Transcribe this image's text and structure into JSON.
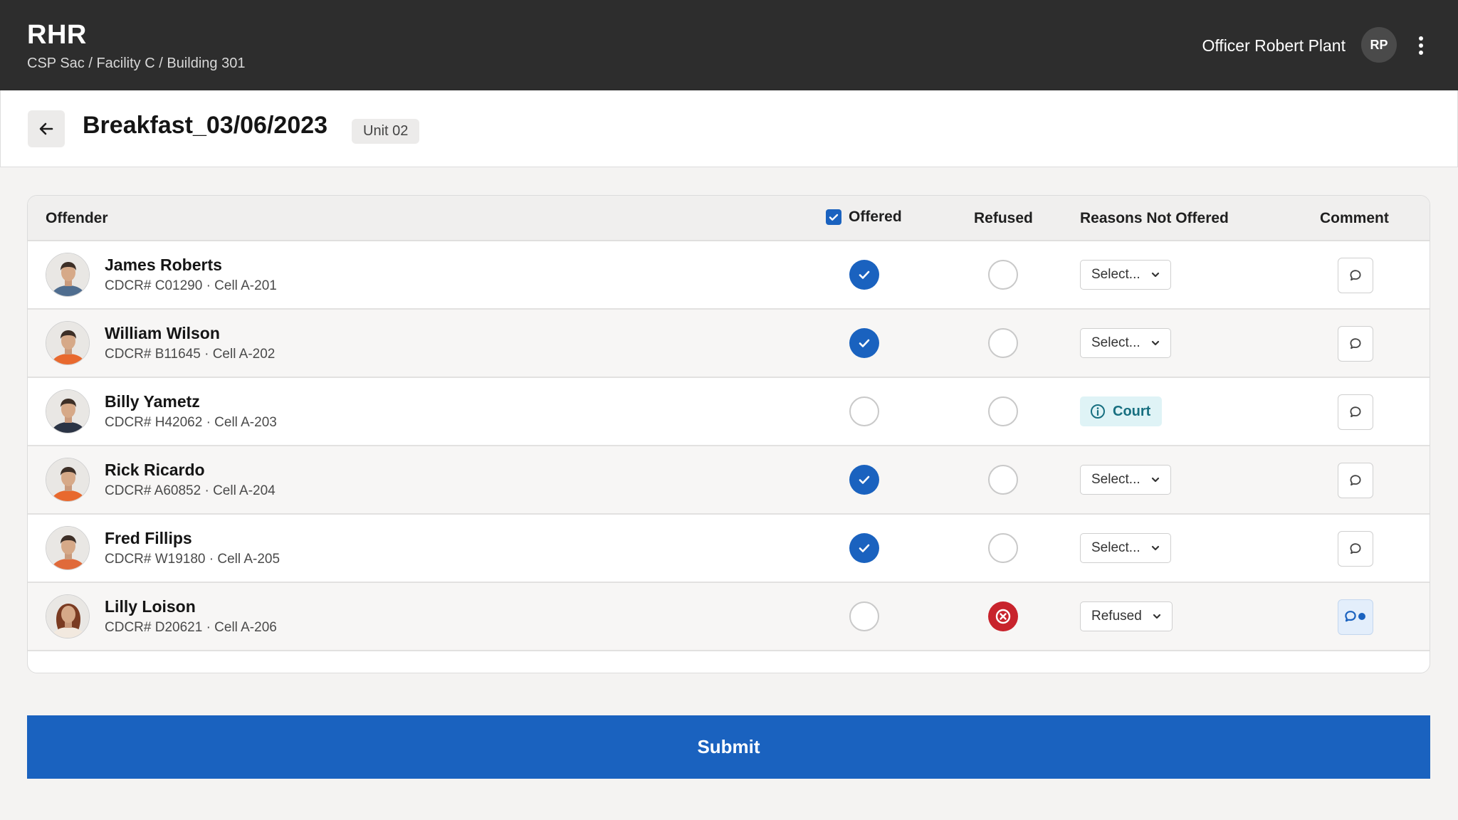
{
  "header": {
    "app_name": "RHR",
    "breadcrumb": "CSP Sac / Facility C / Building 301",
    "officer_name": "Officer Robert Plant",
    "officer_initials": "RP"
  },
  "page": {
    "title": "Breakfast_03/06/2023",
    "unit": "Unit 02"
  },
  "table": {
    "columns": {
      "offender": "Offender",
      "offered": "Offered",
      "refused": "Refused",
      "reasons": "Reasons Not Offered",
      "comment": "Comment"
    },
    "rows": [
      {
        "name": "James Roberts",
        "meta": "CDCR# C01290 · Cell A-201",
        "offered": true,
        "refused": false,
        "reason": "Select...",
        "reason_kind": "select",
        "has_comment": false,
        "shirt": "#4f6d8f"
      },
      {
        "name": "William Wilson",
        "meta": "CDCR# B11645 · Cell A-202",
        "offered": true,
        "refused": false,
        "reason": "Select...",
        "reason_kind": "select",
        "has_comment": false,
        "shirt": "#e8692e"
      },
      {
        "name": "Billy Yametz",
        "meta": "CDCR# H42062 · Cell A-203",
        "offered": false,
        "refused": false,
        "reason": "Court",
        "reason_kind": "badge",
        "has_comment": false,
        "shirt": "#2b3445"
      },
      {
        "name": "Rick Ricardo",
        "meta": "CDCR# A60852 · Cell A-204",
        "offered": true,
        "refused": false,
        "reason": "Select...",
        "reason_kind": "select",
        "has_comment": false,
        "shirt": "#e8692e"
      },
      {
        "name": "Fred Fillips",
        "meta": "CDCR# W19180 · Cell A-205",
        "offered": true,
        "refused": false,
        "reason": "Select...",
        "reason_kind": "select",
        "has_comment": false,
        "shirt": "#e06a3a"
      },
      {
        "name": "Lilly Loison",
        "meta": "CDCR# D20621 · Cell A-206",
        "offered": false,
        "refused": true,
        "reason": "Refused",
        "reason_kind": "select",
        "has_comment": true,
        "shirt": "#f2e9df"
      }
    ]
  },
  "submit_label": "Submit",
  "colors": {
    "primary": "#1a62bf",
    "danger": "#c8232c",
    "topbar": "#2d2d2d",
    "info_bg": "#dff3f6",
    "info_text": "#176f80"
  }
}
